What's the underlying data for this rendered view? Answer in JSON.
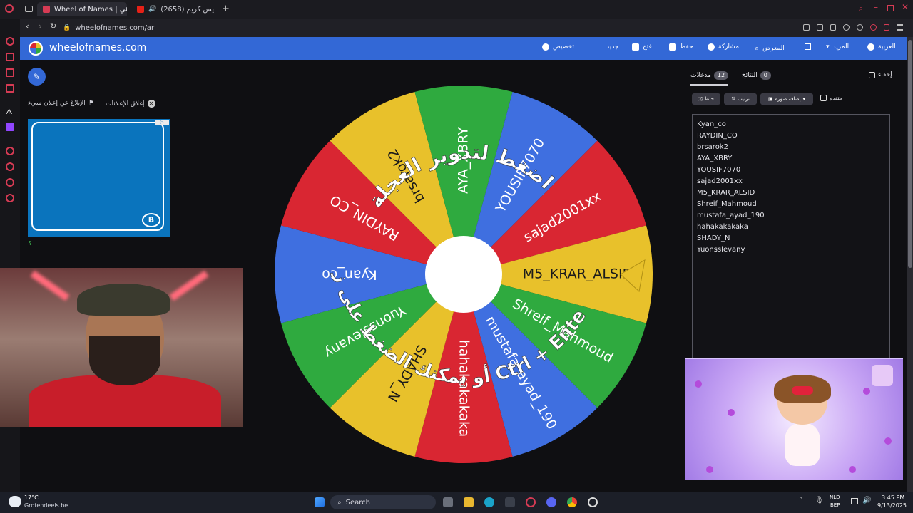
{
  "browser": {
    "tabs": [
      {
        "label": "Wheel of Names | عشوائي",
        "favicon_color": "#d63b54"
      },
      {
        "label": "(2658) أغنية ايس كريم",
        "favicon_color": "#e62117"
      }
    ],
    "url": "wheelofnames.com/ar"
  },
  "site": {
    "title": "wheelofnames.com",
    "nav": {
      "customize": "تخصيص",
      "new": "جديد",
      "open": "فتح",
      "save": "حفظ",
      "share": "مشاركة",
      "gallery": "المعرض",
      "more": "المزيد",
      "language": "العربية"
    }
  },
  "ads": {
    "report": "الإبلاغ عن إعلان سيء",
    "close": "إغلاق الإعلانات",
    "brand_letter": "B",
    "mini_label": "؟"
  },
  "wheel": {
    "segments": [
      {
        "name": "Kyan_co",
        "color": "#3f6fe0"
      },
      {
        "name": "RAYDIN_CO",
        "color": "#d92632"
      },
      {
        "name": "brsarok2",
        "color": "#e8c12b"
      },
      {
        "name": "AYA_XBRY",
        "color": "#2faa3f"
      },
      {
        "name": "YOUSIF7070",
        "color": "#3f6fe0"
      },
      {
        "name": "sajad2001xx",
        "color": "#d92632"
      },
      {
        "name": "M5_KRAR_ALSID",
        "color": "#e8c12b"
      },
      {
        "name": "Shreif_Mahmoud",
        "color": "#2faa3f"
      },
      {
        "name": "mustafa_ayad_190",
        "color": "#3f6fe0"
      },
      {
        "name": "hahakakakaka",
        "color": "#d92632"
      },
      {
        "name": "SHADY_N",
        "color": "#e8c12b"
      },
      {
        "name": "Yuonsslevany",
        "color": "#2faa3f"
      }
    ],
    "overlay_top": "اضغط لتدوير العجلة",
    "overlay_bottom": "أو يمكنك الضغط على زر Ctrl + Enter"
  },
  "panel": {
    "hide_label": "إخفاء",
    "entries_tab": "مدخلات",
    "entries_count": "12",
    "results_tab": "النتائج",
    "results_count": "0",
    "shuffle": "خلط",
    "sort": "ترتيب",
    "add_image": "إضافة صورة",
    "advanced": "متقدم",
    "entries": [
      "Kyan_co",
      "RAYDIN_CO",
      "brsarok2",
      "AYA_XBRY",
      "YOUSIF7070",
      "sajad2001xx",
      "M5_KRAR_ALSID",
      "Shreif_Mahmoud",
      "mustafa_ayad_190",
      "hahakakakaka",
      "SHADY_N",
      "Yuonsslevany"
    ]
  },
  "taskbar": {
    "weather_temp": "17°C",
    "weather_text": "Grotendeels be...",
    "search": "Search",
    "lang_1": "NLD",
    "lang_2": "BEP",
    "time": "3:45 PM",
    "date": "9/13/2025"
  }
}
